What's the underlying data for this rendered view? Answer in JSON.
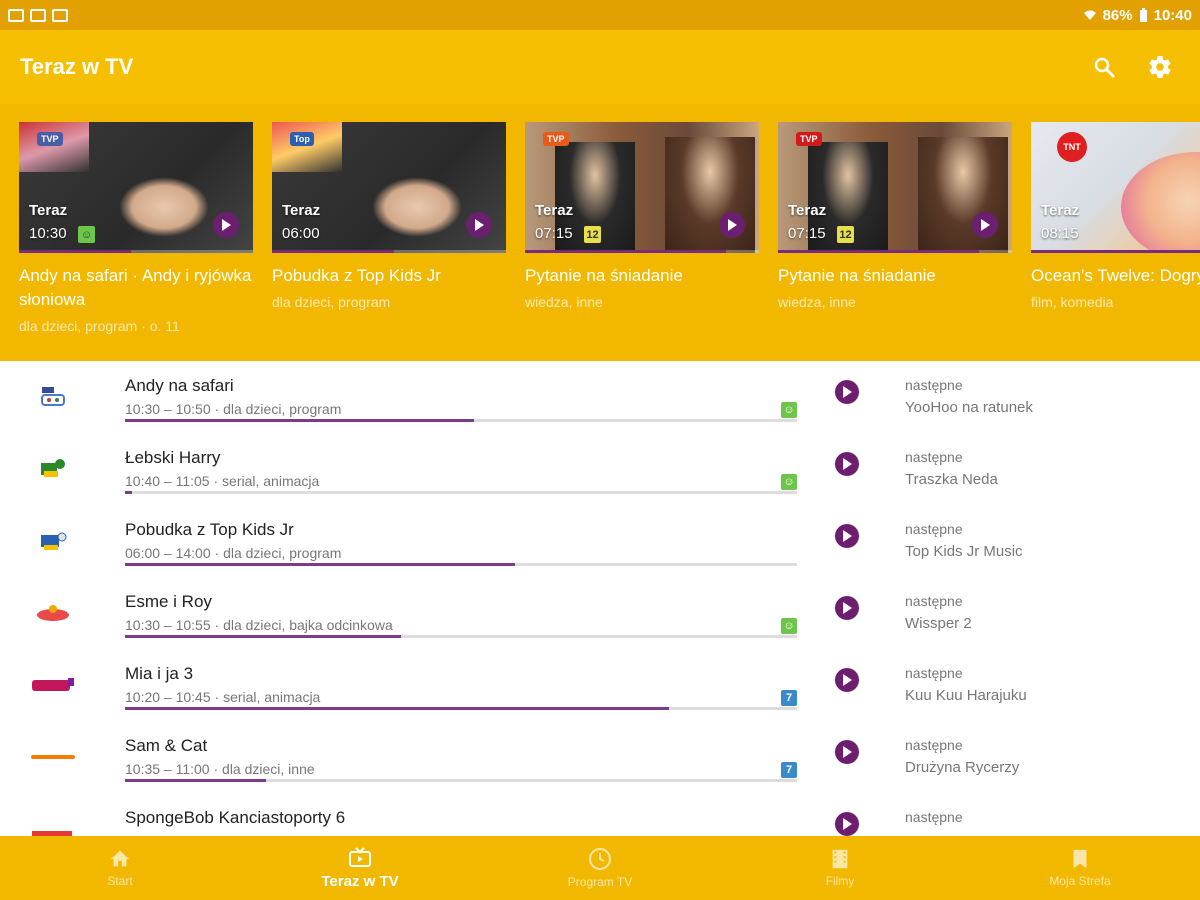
{
  "status_bar": {
    "battery": "86%",
    "time": "10:40",
    "icons": [
      "gallery-icon",
      "mail-icon",
      "screenshot-icon",
      "wifi-icon"
    ]
  },
  "app_bar": {
    "title": "Teraz w TV",
    "icons": [
      "search-icon",
      "settings-icon"
    ]
  },
  "colors": {
    "accent": "#f5bf00",
    "statusbar": "#e3a001",
    "play": "#6b1f6f",
    "progress": "#7b3d8a"
  },
  "featured": [
    {
      "now_label": "Teraz",
      "time": "10:30",
      "title": "Andy na safari · Andy i ryjówka słoniowa",
      "genre": "dla dzieci, program · o. 11",
      "rating_icon": "smile-icon",
      "progress": 0.48
    },
    {
      "now_label": "Teraz",
      "time": "06:00",
      "title": "Pobudka z Top Kids Jr",
      "genre": "dla dzieci, program",
      "rating_icon": "",
      "progress": 0.52
    },
    {
      "now_label": "Teraz",
      "time": "07:15",
      "title": "Pytanie na śniadanie",
      "genre": "wiedza, inne",
      "rating": "12",
      "progress": 0.86
    },
    {
      "now_label": "Teraz",
      "time": "07:15",
      "title": "Pytanie na śniadanie",
      "genre": "wiedza, inne",
      "rating": "12",
      "progress": 0.86
    },
    {
      "now_label": "Teraz",
      "time": "08:15",
      "title": "Ocean's Twelve: Dogrywka",
      "genre": "film, komedia",
      "rating": "",
      "progress": 0.9
    }
  ],
  "list": [
    {
      "title": "Andy na safari",
      "meta": "10:30 – 10:50 · dla dzieci, program",
      "progress": 0.52,
      "rating_icon": "smile-icon",
      "next_label": "następne",
      "next_title": "YooHoo na ratunek"
    },
    {
      "title": "Łebski Harry",
      "meta": "10:40 – 11:05 · serial, animacja",
      "progress": 0.01,
      "rating_icon": "smile-icon",
      "next_label": "następne",
      "next_title": "Traszka Neda"
    },
    {
      "title": "Pobudka z Top Kids Jr",
      "meta": "06:00 – 14:00 · dla dzieci, program",
      "progress": 0.58,
      "rating_icon": "",
      "next_label": "następne",
      "next_title": "Top Kids Jr Music"
    },
    {
      "title": "Esme i Roy",
      "meta": "10:30 – 10:55 · dla dzieci, bajka odcinkowa",
      "progress": 0.41,
      "rating_icon": "smile-icon",
      "next_label": "następne",
      "next_title": "Wissper 2"
    },
    {
      "title": "Mia i ja 3",
      "meta": "10:20 – 10:45 · serial, animacja",
      "progress": 0.81,
      "rating": "7",
      "next_label": "następne",
      "next_title": "Kuu Kuu Harajuku"
    },
    {
      "title": "Sam & Cat",
      "meta": "10:35 – 11:00 · dla dzieci, inne",
      "progress": 0.21,
      "rating": "7",
      "next_label": "następne",
      "next_title": "Drużyna Rycerzy"
    },
    {
      "title": "SpongeBob Kanciastoporty 6",
      "meta": "",
      "progress": 0,
      "rating": "",
      "next_label": "następne",
      "next_title": ""
    }
  ],
  "bottom_nav": [
    {
      "label": "Start",
      "icon": "home-icon",
      "active": false
    },
    {
      "label": "Teraz w TV",
      "icon": "tv-icon",
      "active": true
    },
    {
      "label": "Program TV",
      "icon": "clock-icon",
      "active": false
    },
    {
      "label": "Filmy",
      "icon": "film-icon",
      "active": false
    },
    {
      "label": "Moja Strefa",
      "icon": "bookmark-icon",
      "active": false
    }
  ]
}
